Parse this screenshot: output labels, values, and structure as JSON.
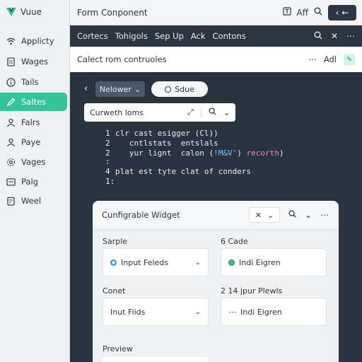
{
  "app": {
    "name": "Vuue",
    "accent": "#36c29a",
    "logo_color": "#36c29a"
  },
  "sidebar": {
    "items": [
      {
        "label": "Applicty",
        "icon": "wifi-icon",
        "active": false
      },
      {
        "label": "Wages",
        "icon": "document-icon",
        "active": false
      },
      {
        "label": "Tails",
        "icon": "info-circle-icon",
        "active": false
      },
      {
        "label": "Saltes",
        "icon": "pencil-icon",
        "active": true
      },
      {
        "label": "Falrs",
        "icon": "person-icon",
        "active": false
      },
      {
        "label": "Paye",
        "icon": "person-icon",
        "active": false
      },
      {
        "label": "Vages",
        "icon": "gear-icon",
        "active": false
      },
      {
        "label": "Palg",
        "icon": "folder-icon",
        "active": false
      },
      {
        "label": "Weel",
        "icon": "clipboard-icon",
        "active": false
      }
    ]
  },
  "titlebar": {
    "title": "Form Conponent",
    "tool_label": "Aff",
    "back_label": "←"
  },
  "menubar": {
    "items": [
      "Cortecs",
      "Tohigols",
      "Sep Up",
      "Ack",
      "Contons"
    ]
  },
  "subbar": {
    "title": "Calect rom contruoles",
    "action_label": "Adl"
  },
  "filters": {
    "network_label": "Nelower",
    "source_label": "Sdue"
  },
  "search": {
    "value": "Curweth loms"
  },
  "code": {
    "lines": [
      {
        "num": "1",
        "text": "clr cast esigger (Cl))"
      },
      {
        "num": "2",
        "text": "   cntlstats  entslals"
      },
      {
        "num": "2",
        "text": "   yur lignt  calon (",
        "highlight": "!M&V'",
        "tail": ") ",
        "pink": "recorth",
        "end": ")"
      },
      {
        "num": ":",
        "text": ""
      },
      {
        "num": "4",
        "text": "plat est tyte clat of conders"
      },
      {
        "num": "1:",
        "text": ""
      }
    ]
  },
  "widget": {
    "title": "Cunfigrable Widget",
    "fields": [
      {
        "label": "Sarple",
        "value": "Input Feleds",
        "icon": "radio-icon",
        "control": "chevron-updown"
      },
      {
        "label": "6 Cade",
        "value": "Indi Eigren",
        "icon": "green-dot-icon",
        "control": ""
      },
      {
        "label": "Conet",
        "value": "Inut Fiids",
        "icon": "",
        "control": "chevron-down"
      },
      {
        "label": "2 14 jpur Plewls",
        "value": "Indi Eigren",
        "icon": "dots-icon",
        "control": ""
      }
    ],
    "preview_label": "Preview"
  }
}
